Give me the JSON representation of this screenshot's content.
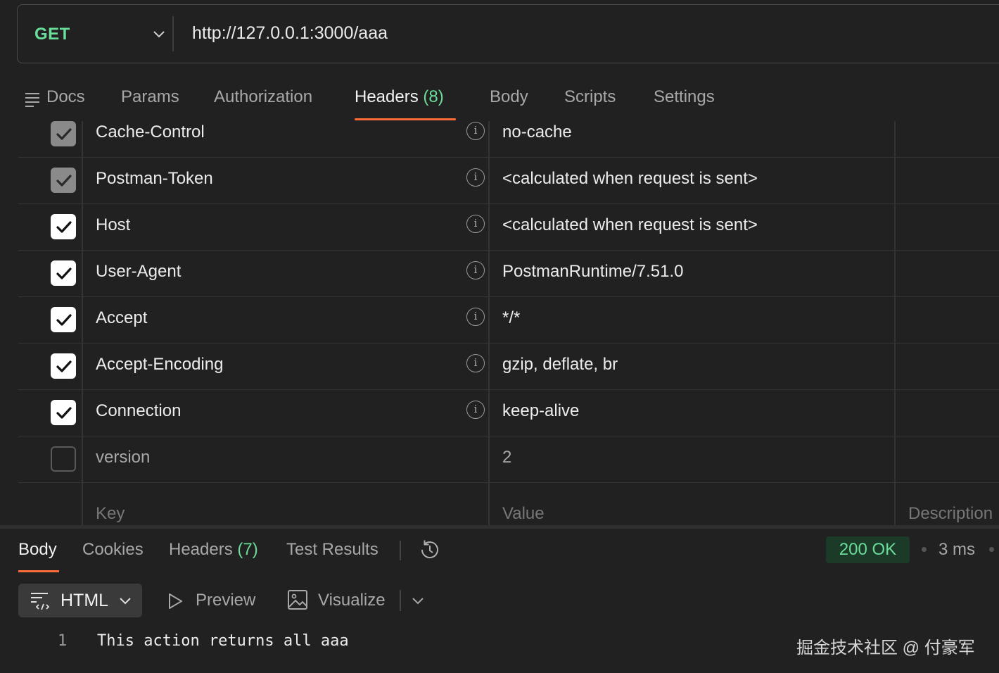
{
  "request": {
    "method": "GET",
    "url": "http://127.0.0.1:3000/aaa"
  },
  "request_tabs": [
    {
      "label": "Docs"
    },
    {
      "label": "Params"
    },
    {
      "label": "Authorization"
    },
    {
      "label": "Headers",
      "count": "(8)"
    },
    {
      "label": "Body"
    },
    {
      "label": "Scripts"
    },
    {
      "label": "Settings"
    }
  ],
  "headers_table": {
    "rows": [
      {
        "checked": "locked",
        "key": "Cache-Control",
        "value": "no-cache"
      },
      {
        "checked": "locked",
        "key": "Postman-Token",
        "value": "<calculated when request is sent>"
      },
      {
        "checked": "true",
        "key": "Host",
        "value": "<calculated when request is sent>"
      },
      {
        "checked": "true",
        "key": "User-Agent",
        "value": "PostmanRuntime/7.51.0"
      },
      {
        "checked": "true",
        "key": "Accept",
        "value": "*/*"
      },
      {
        "checked": "true",
        "key": "Accept-Encoding",
        "value": "gzip, deflate, br"
      },
      {
        "checked": "true",
        "key": "Connection",
        "value": "keep-alive"
      },
      {
        "checked": "false",
        "key": "version",
        "value": "2"
      }
    ],
    "info_glyph": "i",
    "placeholders": {
      "key": "Key",
      "value": "Value",
      "description": "Description"
    }
  },
  "response": {
    "tabs": [
      {
        "label": "Body"
      },
      {
        "label": "Cookies"
      },
      {
        "label": "Headers",
        "count": "(7)"
      },
      {
        "label": "Test Results"
      }
    ],
    "status": "200 OK",
    "time": "3 ms",
    "format": "HTML",
    "preview_label": "Preview",
    "visualize_label": "Visualize",
    "line_number": "1",
    "body_text": "This action returns all aaa"
  },
  "watermark": "掘金技术社区 @ 付豪军",
  "colors": {
    "accent": "#ff6c37",
    "method_green": "#6bdd9a",
    "status_bg": "#1b3a28"
  }
}
